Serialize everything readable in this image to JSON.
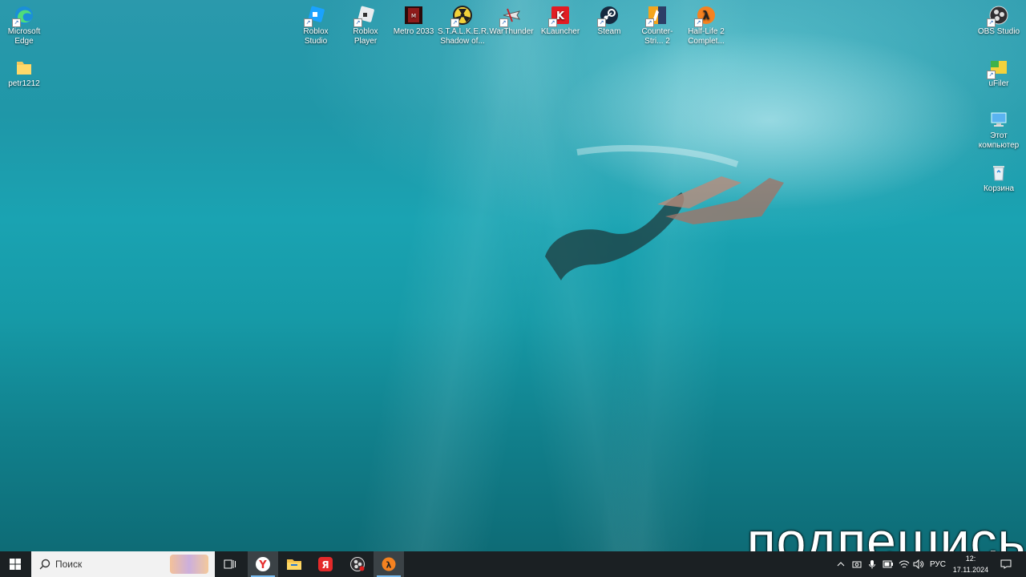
{
  "desktop": {
    "icons": [
      {
        "label": "Microsoft Edge",
        "icon": "edge-icon"
      },
      {
        "label": "petr1212",
        "icon": "folder-icon"
      },
      {
        "label": "Roblox Studio",
        "icon": "roblox-studio-icon"
      },
      {
        "label": "Roblox Player",
        "icon": "roblox-player-icon"
      },
      {
        "label": "Metro 2033",
        "icon": "metro-2033-icon"
      },
      {
        "label": "S.T.A.L.K.E.R. Shadow of...",
        "icon": "stalker-icon"
      },
      {
        "label": "WarThunder",
        "icon": "warthunder-icon"
      },
      {
        "label": "KLauncher",
        "icon": "klauncher-icon"
      },
      {
        "label": "Steam",
        "icon": "steam-icon"
      },
      {
        "label": "Counter-Stri... 2",
        "icon": "counter-strike-icon"
      },
      {
        "label": "Half-Life 2 Complet...",
        "icon": "half-life-icon"
      },
      {
        "label": "OBS Studio",
        "icon": "obs-icon"
      },
      {
        "label": "uFiler",
        "icon": "ufiler-icon"
      },
      {
        "label": "Этот компьютер",
        "icon": "computer-icon"
      },
      {
        "label": "Корзина",
        "icon": "recycle-bin-icon"
      }
    ]
  },
  "overlay_text": "подпешись",
  "taskbar": {
    "search_placeholder": "Поиск",
    "language": "РУС",
    "time": "12:",
    "date": "17.11.2024",
    "apps": [
      "start-icon",
      "task-view-icon",
      "yandex-browser-icon",
      "file-explorer-icon",
      "yandex-icon",
      "obs-icon",
      "half-life-icon"
    ]
  },
  "colors": {
    "taskbar": "#1b2023",
    "accent": "#76b9ed",
    "water": "#1aa3b2"
  }
}
